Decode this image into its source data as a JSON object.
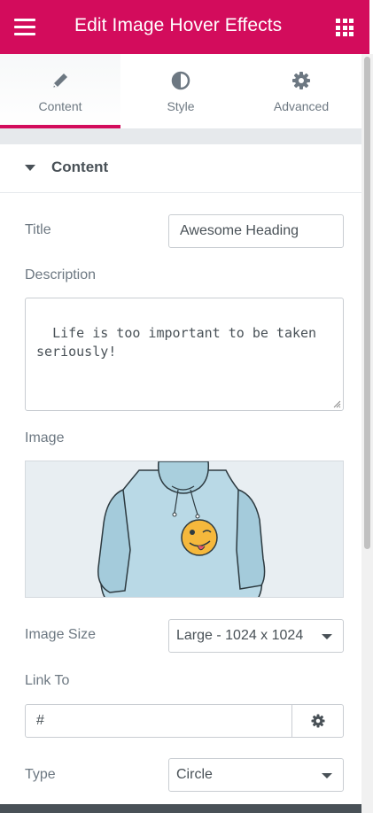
{
  "header": {
    "title": "Edit Image Hover Effects",
    "menu_icon": "hamburger-icon",
    "apps_icon": "grid-icon",
    "color": "#d30c5c"
  },
  "tabs": [
    {
      "label": "Content",
      "icon": "pencil-icon",
      "active": true
    },
    {
      "label": "Style",
      "icon": "half-circle-icon",
      "active": false
    },
    {
      "label": "Advanced",
      "icon": "gear-icon",
      "active": false
    }
  ],
  "section": {
    "label": "Content",
    "icon": "caret-down-icon"
  },
  "fields": {
    "title": {
      "label": "Title",
      "value": "Awesome Heading"
    },
    "description": {
      "label": "Description",
      "value": "Life is too important to be taken\nseriously!"
    },
    "image": {
      "label": "Image"
    },
    "image_size": {
      "label": "Image Size",
      "value": "Large - 1024 x 1024"
    },
    "link_to": {
      "label": "Link To",
      "value": "#"
    },
    "type": {
      "label": "Type",
      "value": "Circle"
    }
  }
}
